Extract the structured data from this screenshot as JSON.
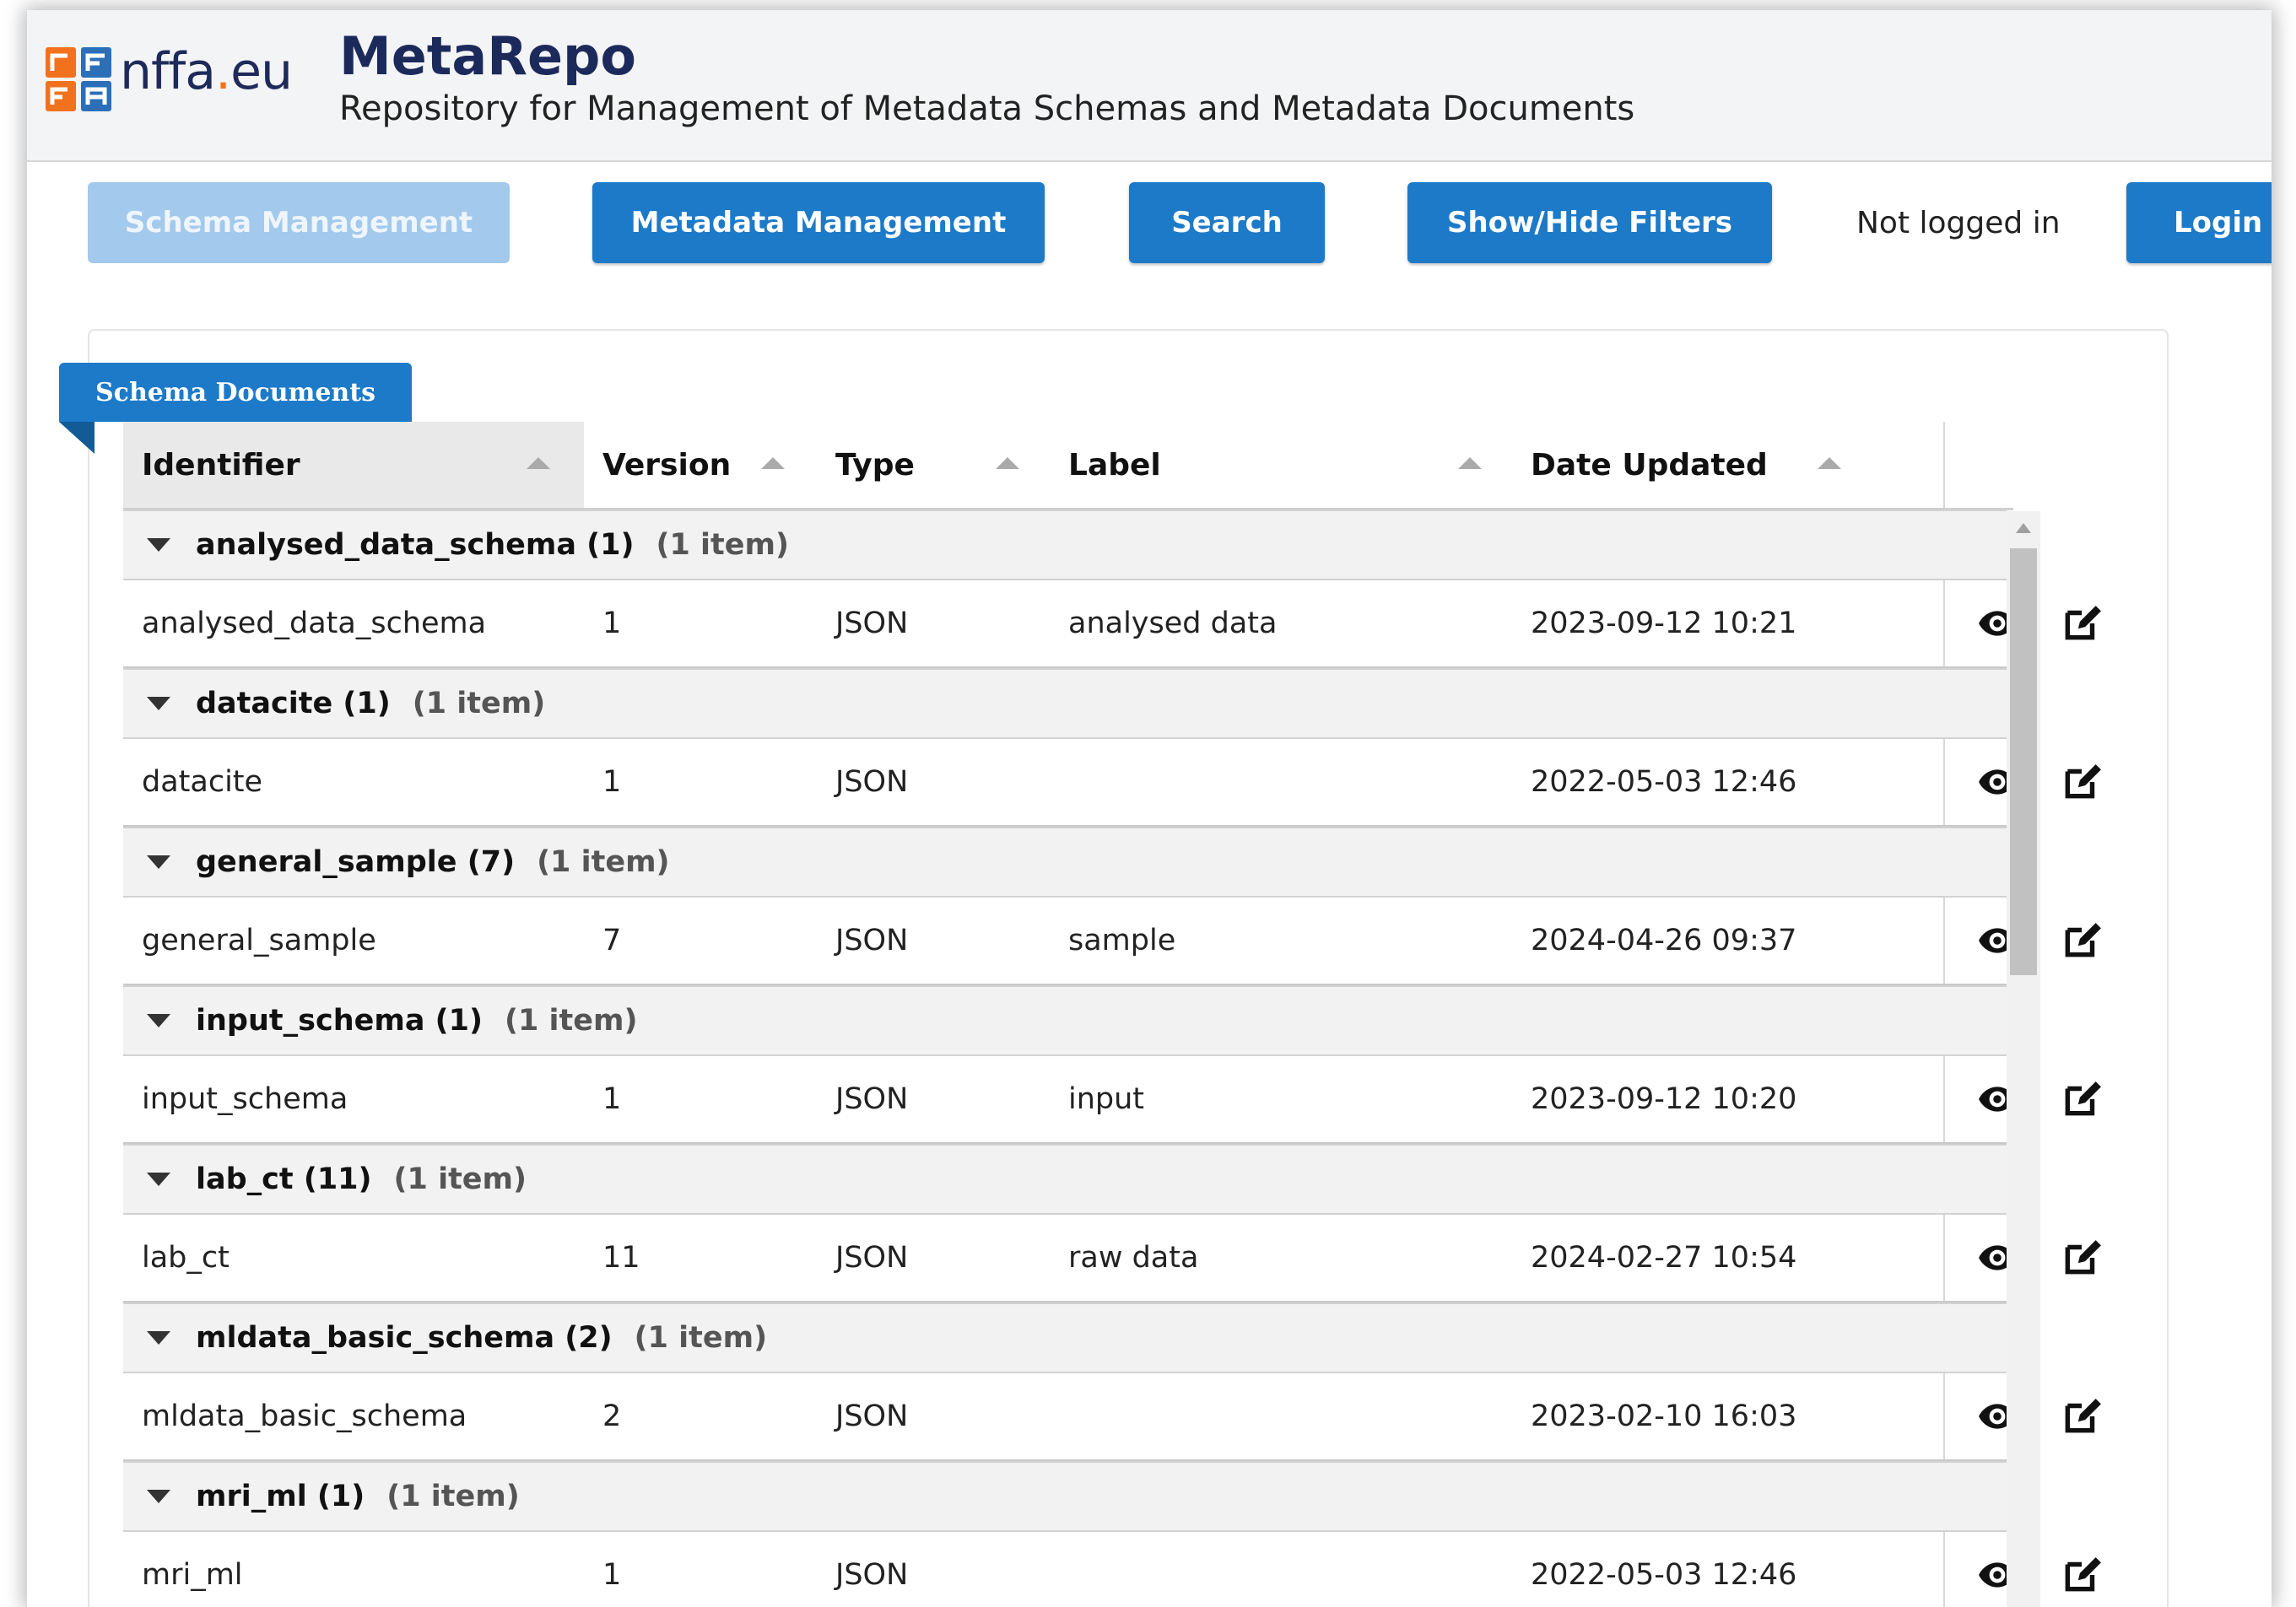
{
  "header": {
    "logo_text_main": "nffa",
    "logo_text_dot": ".",
    "logo_text_tld": "eu",
    "title": "MetaRepo",
    "subtitle": "Repository for Management of Metadata Schemas and Metadata Documents"
  },
  "nav": {
    "schema_management": "Schema Management",
    "metadata_management": "Metadata Management",
    "search": "Search",
    "show_hide_filters": "Show/Hide Filters",
    "login_status": "Not logged in",
    "login": "Login"
  },
  "panel": {
    "tab_label": "Schema Documents"
  },
  "table": {
    "columns": {
      "identifier": "Identifier",
      "version": "Version",
      "type": "Type",
      "label": "Label",
      "date_updated": "Date Updated"
    },
    "groups": [
      {
        "name": "analysed_data_schema (1)",
        "count": "(1 item)",
        "identifier": "analysed_data_schema",
        "version": "1",
        "type": "JSON",
        "label": "analysed data",
        "date": "2023-09-12 10:21"
      },
      {
        "name": "datacite (1)",
        "count": "(1 item)",
        "identifier": "datacite",
        "version": "1",
        "type": "JSON",
        "label": "",
        "date": "2022-05-03 12:46"
      },
      {
        "name": "general_sample (7)",
        "count": "(1 item)",
        "identifier": "general_sample",
        "version": "7",
        "type": "JSON",
        "label": "sample",
        "date": "2024-04-26 09:37"
      },
      {
        "name": "input_schema (1)",
        "count": "(1 item)",
        "identifier": "input_schema",
        "version": "1",
        "type": "JSON",
        "label": "input",
        "date": "2023-09-12 10:20"
      },
      {
        "name": "lab_ct (11)",
        "count": "(1 item)",
        "identifier": "lab_ct",
        "version": "11",
        "type": "JSON",
        "label": "raw data",
        "date": "2024-02-27 10:54"
      },
      {
        "name": "mldata_basic_schema (2)",
        "count": "(1 item)",
        "identifier": "mldata_basic_schema",
        "version": "2",
        "type": "JSON",
        "label": "",
        "date": "2023-02-10 16:03"
      },
      {
        "name": "mri_ml (1)",
        "count": "(1 item)",
        "identifier": "mri_ml",
        "version": "1",
        "type": "JSON",
        "label": "",
        "date": "2022-05-03 12:46"
      }
    ]
  },
  "icons": {
    "view": "eye-icon",
    "edit": "edit-icon"
  },
  "colors": {
    "primary": "#1c7ac9",
    "primary_disabled": "#a3c9ec",
    "title": "#1c2a5b",
    "logo_orange": "#f2711c",
    "logo_blue": "#2a6fb8"
  }
}
